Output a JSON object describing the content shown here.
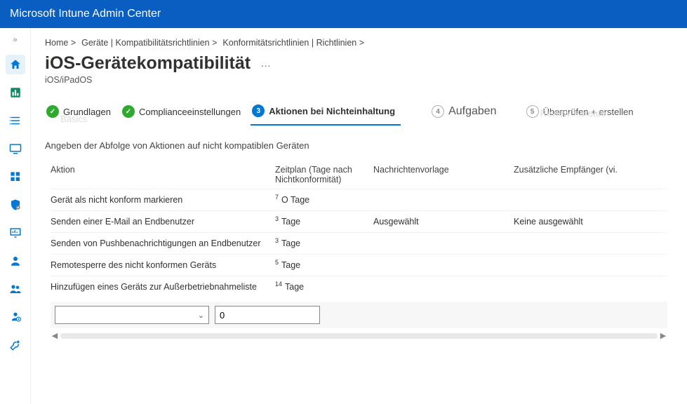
{
  "header": {
    "title": "Microsoft Intune Admin Center"
  },
  "breadcrumb": {
    "items": [
      "Home >",
      "Geräte | Kompatibilitätsrichtlinien >",
      "Konformitätsrichtlinien | Richtlinien >"
    ]
  },
  "page": {
    "title": "iOS-Gerätekompatibilität",
    "more": "…",
    "subtitle": "iOS/iPadOS"
  },
  "wizard": {
    "steps": [
      {
        "num": "✓",
        "label": "Grundlagen",
        "faint": "Basics"
      },
      {
        "num": "✓",
        "label": "Complianceeinstellungen"
      },
      {
        "num": "3",
        "label": "Aktionen bei Nichteinhaltung"
      },
      {
        "num": "4",
        "label": "Aufgaben"
      },
      {
        "num": "5",
        "label": "Überprüfen + erstellen",
        "faint": "Review + create"
      }
    ]
  },
  "section": {
    "label": "Angeben der Abfolge von Aktionen auf nicht kompatiblen Geräten"
  },
  "table": {
    "headers": {
      "action": "Aktion",
      "schedule": "Zeitplan (Tage nach Nichtkonformität)",
      "template": "Nachrichtenvorlage",
      "recipients": "Zusätzliche Empfänger (vi."
    },
    "rows": [
      {
        "action": "Gerät als nicht konform markieren",
        "sup": "7",
        "days": "O Tage",
        "template": "",
        "recipients": ""
      },
      {
        "action": "Senden einer E-Mail an Endbenutzer",
        "sup": "3",
        "days": "Tage",
        "template": "Ausgewählt",
        "recipients": "Keine ausgewählt"
      },
      {
        "action": "Senden von Pushbenachrichtigungen an Endbenutzer",
        "sup": "3",
        "days": "Tage",
        "template": "",
        "recipients": ""
      },
      {
        "action": "Remotesperre des nicht konformen Geräts",
        "sup": "5",
        "days": "Tage",
        "template": "",
        "recipients": ""
      },
      {
        "action": "Hinzufügen eines Geräts zur Außerbetriebnahmeliste",
        "sup": "14",
        "days": "Tage",
        "template": "",
        "recipients": ""
      }
    ]
  },
  "inputs": {
    "number_value": "0"
  }
}
